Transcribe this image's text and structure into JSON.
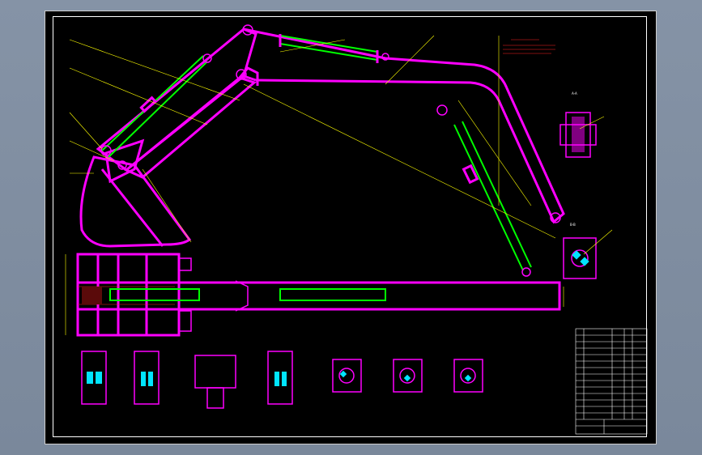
{
  "drawing": {
    "colors": {
      "background_chrome": "#7f8da0",
      "sheet": "#000000",
      "structure": "#ff00ff",
      "cylinder": "#00ff00",
      "leader": "#ffff00",
      "title_block": "#ffffff",
      "section_fill": "#00e5ff"
    }
  }
}
